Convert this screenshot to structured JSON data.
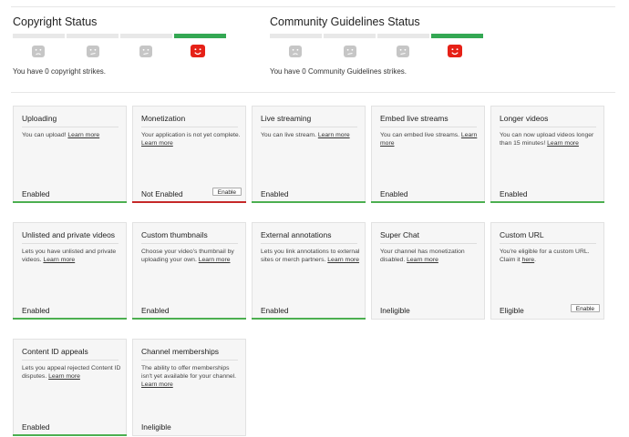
{
  "copyright": {
    "title": "Copyright Status",
    "strikes_text": "You have 0 copyright strikes.",
    "active_index": 3,
    "face_icons": [
      "sad-face-icon",
      "neutral-face-icon",
      "neutral-face-icon",
      "happy-face-icon"
    ]
  },
  "guidelines": {
    "title": "Community Guidelines Status",
    "strikes_text": "You have 0 Community Guidelines strikes.",
    "active_index": 3,
    "face_icons": [
      "sad-face-icon",
      "neutral-face-icon",
      "neutral-face-icon",
      "happy-face-icon"
    ]
  },
  "colors": {
    "green": "#4caf50",
    "red": "#c62828",
    "active_face": "#e62117",
    "inactive_face": "#c6c6c6"
  },
  "features": [
    {
      "id": "uploading",
      "title": "Uploading",
      "desc": "You can upload!",
      "link": "Learn more",
      "status": "Enabled",
      "bar": "green",
      "button": ""
    },
    {
      "id": "monetization",
      "title": "Monetization",
      "desc": "Your application is not yet complete.",
      "link": "Learn more",
      "status": "Not Enabled",
      "bar": "red",
      "button": "Enable"
    },
    {
      "id": "live-streaming",
      "title": "Live streaming",
      "desc": "You can live stream.",
      "link": "Learn more",
      "status": "Enabled",
      "bar": "green",
      "button": ""
    },
    {
      "id": "embed-live-streams",
      "title": "Embed live streams",
      "desc": "You can embed live streams.",
      "link": "Learn more",
      "status": "Enabled",
      "bar": "green",
      "button": ""
    },
    {
      "id": "longer-videos",
      "title": "Longer videos",
      "desc": "You can now upload videos longer than 15 minutes!",
      "link": "Learn more",
      "status": "Enabled",
      "bar": "green",
      "button": ""
    },
    {
      "id": "unlisted-private",
      "title": "Unlisted and private videos",
      "desc": "Lets you have unlisted and private videos.",
      "link": "Learn more",
      "status": "Enabled",
      "bar": "green",
      "button": ""
    },
    {
      "id": "custom-thumbnails",
      "title": "Custom thumbnails",
      "desc": "Choose your video's thumbnail by uploading your own.",
      "link": "Learn more",
      "status": "Enabled",
      "bar": "green",
      "button": ""
    },
    {
      "id": "external-annotations",
      "title": "External annotations",
      "desc": "Lets you link annotations to external sites or merch partners.",
      "link": "Learn more",
      "status": "Enabled",
      "bar": "green",
      "button": ""
    },
    {
      "id": "super-chat",
      "title": "Super Chat",
      "desc": "Your channel has monetization disabled.",
      "link": "Learn more",
      "status": "Ineligible",
      "bar": "none",
      "button": ""
    },
    {
      "id": "custom-url",
      "title": "Custom URL",
      "desc": "You're eligible for a custom URL. Claim it",
      "link": "here",
      "link_suffix": ".",
      "status": "Eligible",
      "bar": "none",
      "button": "Enable"
    },
    {
      "id": "content-id-appeals",
      "title": "Content ID appeals",
      "desc": "Lets you appeal rejected Content ID disputes.",
      "link": "Learn more",
      "status": "Enabled",
      "bar": "green",
      "button": ""
    },
    {
      "id": "channel-memberships",
      "title": "Channel memberships",
      "desc": "The ability to offer memberships isn't yet available for your channel.",
      "link": "Learn more",
      "status": "Ineligible",
      "bar": "none",
      "button": ""
    }
  ]
}
